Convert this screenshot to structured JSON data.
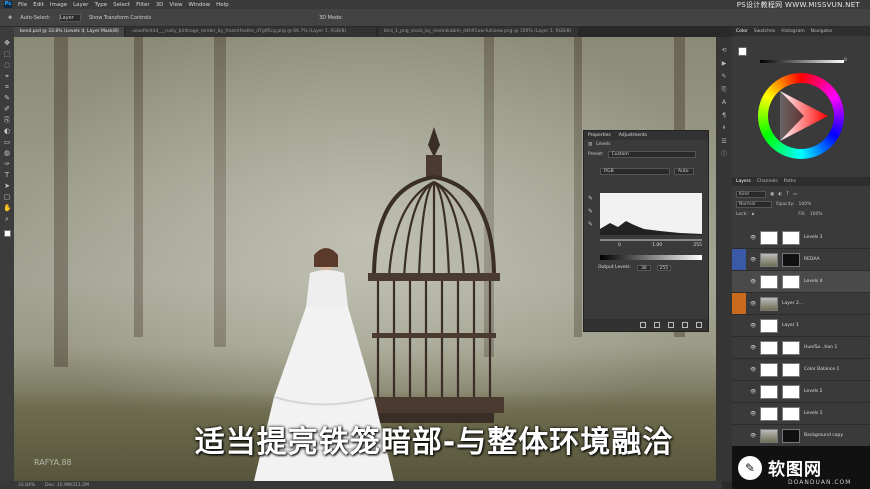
{
  "app": {
    "logo": "Ps",
    "watermark": "PS设计教程网 WWW.MISSVUN.NET"
  },
  "menu": [
    "File",
    "Edit",
    "Image",
    "Layer",
    "Type",
    "Select",
    "Filter",
    "3D",
    "View",
    "Window",
    "Help"
  ],
  "options": {
    "auto_select": "Auto-Select:",
    "layer_dropdown": "Layer",
    "transform": "Show Transform Controls",
    "mode3d": "3D Mode:"
  },
  "tabs": [
    {
      "label": "bend.psd @ 33.8% (Levels 4, Layer Mask/8)",
      "active": true
    },
    {
      "label": "uexofield44___rusty_birdcage_render_by_frozenfeathe_d7g95cg.png @ 66.7% (Layer 1, RGB/8)",
      "active": false
    },
    {
      "label": "bird_1_png_stock_by_memakabim_d4h91aw-fullview.png @ 100% (Layer 1, RGB/8)",
      "active": false
    }
  ],
  "tools": [
    "✥",
    "⬚",
    "◌",
    "⌖",
    "⌗",
    "✎",
    "✐",
    "⎘",
    "◐",
    "▭",
    "◍",
    "✑",
    "T",
    "➤",
    "▢",
    "✋",
    "⌕"
  ],
  "canvas": {
    "subtitle": "适当提亮铁笼暗部-与整体环境融洽",
    "logo": "RAFYA.88"
  },
  "status": {
    "zoom": "33.84%",
    "doc": "Doc: 10.9M/311.2M"
  },
  "properties": {
    "tabs": [
      "Properties",
      "Adjustments"
    ],
    "type_label": "Levels",
    "preset_label": "Preset:",
    "preset_value": "Custom",
    "channel": "RGB",
    "auto_label": "Auto",
    "input_values": [
      "0",
      "1.00",
      "255"
    ],
    "output_label": "Output Levels:",
    "output_values": [
      "30",
      "255"
    ]
  },
  "right_panel": {
    "color_tabs": [
      "Color",
      "Swatches",
      "Histogram",
      "Navigator"
    ],
    "layer_tabs": [
      "Layers",
      "Channels",
      "Paths"
    ],
    "filter": "Kind",
    "blend_mode": "Normal",
    "opacity_label": "Opacity:",
    "opacity": "100%",
    "lock_label": "Lock:",
    "fill_label": "Fill:",
    "fill": "100%",
    "color_value": "0"
  },
  "layers": [
    {
      "name": "Levels 3",
      "thumb": "white",
      "mask": "white",
      "selected": false
    },
    {
      "name": "REDAA",
      "thumb": "photo",
      "mask": "dark",
      "selected": false
    },
    {
      "name": "Levels 4",
      "thumb": "white",
      "mask": "white",
      "selected": true
    },
    {
      "name": "Layer 2...",
      "thumb": "photo",
      "mask": "",
      "selected": false
    },
    {
      "name": "Layer 1",
      "thumb": "white",
      "mask": "",
      "selected": false
    },
    {
      "name": "Hue/Sa...tion 1",
      "thumb": "white",
      "mask": "white",
      "selected": false
    },
    {
      "name": "Color Balance 1",
      "thumb": "white",
      "mask": "white",
      "selected": false
    },
    {
      "name": "Levels 2",
      "thumb": "white",
      "mask": "white",
      "selected": false
    },
    {
      "name": "Levels 1",
      "thumb": "white",
      "mask": "white",
      "selected": false
    },
    {
      "name": "Background copy",
      "thumb": "photo",
      "mask": "dark",
      "selected": false
    }
  ],
  "site_logo": {
    "mark": "✎",
    "text": "软图网",
    "sub": "DOANDUAN.COM"
  },
  "colors": {
    "accent": "#31a8ff",
    "orange_marker": "#c96a1c",
    "blue_marker": "#3a5aa8"
  }
}
